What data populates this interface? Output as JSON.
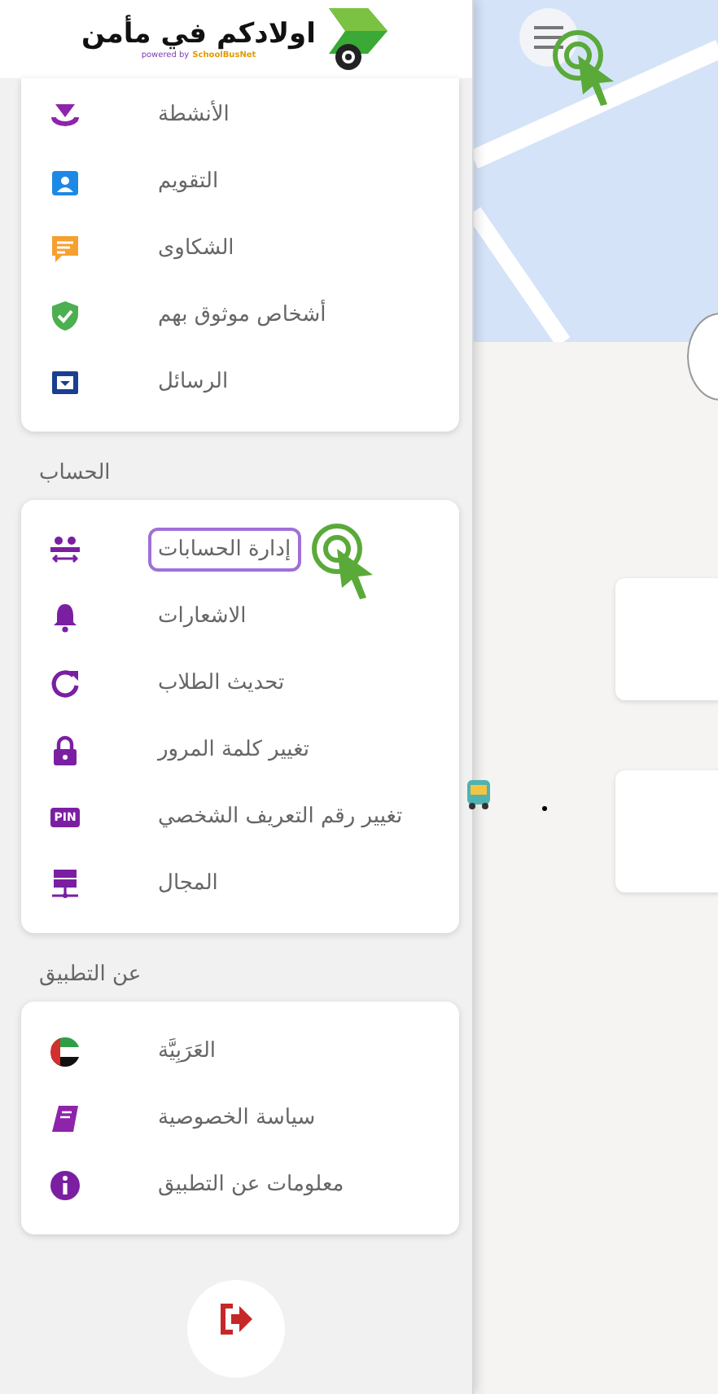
{
  "header": {
    "title": "اولادكم في مأمن",
    "powered_by": "powered by",
    "brand": "SchoolBusNet"
  },
  "sections": [
    {
      "items": [
        {
          "kind": "activities",
          "label": "الأنشطة",
          "highlighted": false
        },
        {
          "kind": "calendar",
          "label": "التقويم",
          "highlighted": false
        },
        {
          "kind": "complaints",
          "label": "الشكاوى",
          "highlighted": false
        },
        {
          "kind": "trusted",
          "label": "أشخاص موثوق بهم",
          "highlighted": false
        },
        {
          "kind": "messages",
          "label": "الرسائل",
          "highlighted": false
        }
      ]
    },
    {
      "heading": "الحساب",
      "items": [
        {
          "kind": "accounts",
          "label": "إدارة الحسابات",
          "highlighted": true
        },
        {
          "kind": "notifications",
          "label": "الاشعارات",
          "highlighted": false
        },
        {
          "kind": "refresh",
          "label": "تحديث الطلاب",
          "highlighted": false
        },
        {
          "kind": "password",
          "label": "تغيير كلمة المرور",
          "highlighted": false
        },
        {
          "kind": "pin",
          "label": "تغيير رقم التعريف الشخصي",
          "highlighted": false
        },
        {
          "kind": "domain",
          "label": "المجال",
          "highlighted": false
        }
      ]
    },
    {
      "heading": "عن التطبيق",
      "items": [
        {
          "kind": "language",
          "label": "العَرَبِيَّة",
          "highlighted": false
        },
        {
          "kind": "privacy",
          "label": "سياسة الخصوصية",
          "highlighted": false
        },
        {
          "kind": "about",
          "label": "معلومات عن التطبيق",
          "highlighted": false
        }
      ]
    }
  ],
  "pin_badge": "PIN"
}
